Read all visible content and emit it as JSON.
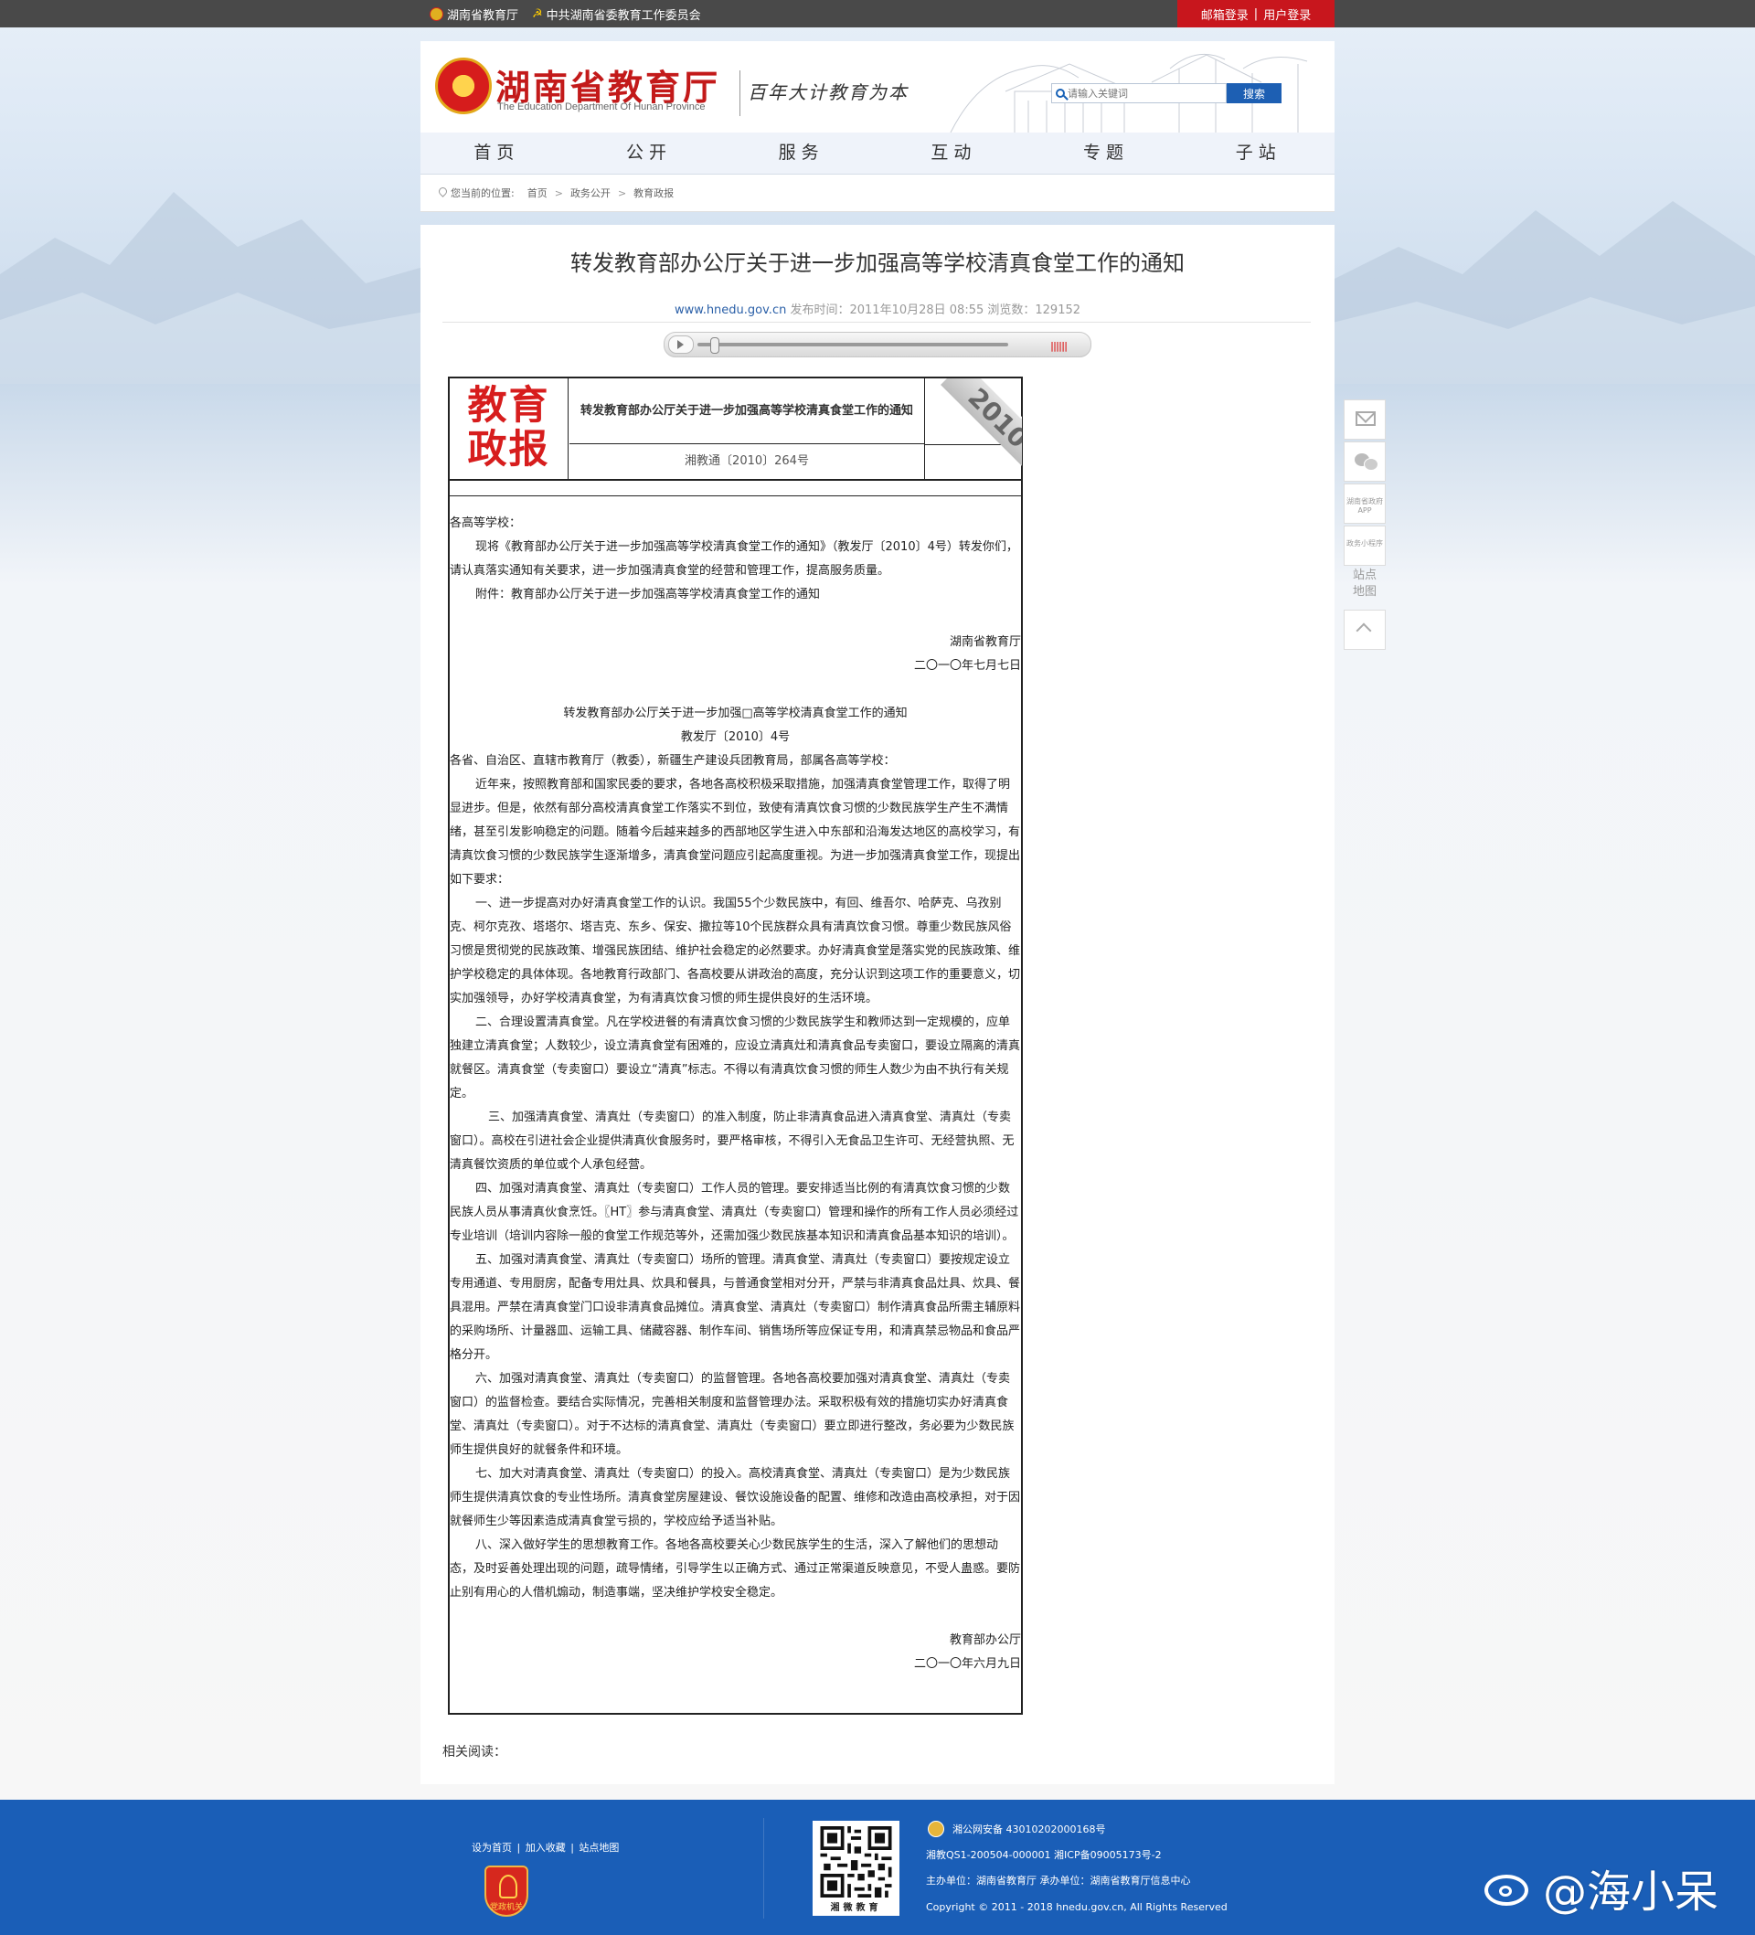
{
  "topbar": {
    "link1": "湖南省教育厅",
    "link2": "中共湖南省委教育工作委员会",
    "mail_login": "邮箱登录",
    "sep": "|",
    "user_login": "用户登录"
  },
  "header": {
    "logo_cn": "湖南省教育厅",
    "logo_en": "The Education Department Of Hunan Province",
    "slogan": "百年大计教育为本",
    "search_placeholder": "请输入关键词",
    "search_button": "搜索"
  },
  "nav": [
    "首页",
    "公开",
    "服务",
    "互动",
    "专题",
    "子站"
  ],
  "breadcrumb": {
    "label": "您当前的位置:",
    "items": [
      "首页",
      "政务公开",
      "教育政报"
    ],
    "sep": ">"
  },
  "article": {
    "title": "转发教育部办公厅关于进一步加强高等学校清真食堂工作的通知",
    "site": "www.hnedu.gov.cn",
    "meta": "发布时间：2011年10月28日 08:55 浏览数：129152",
    "player_volume": "||||||",
    "doc": {
      "stamp_line1": "教育",
      "stamp_line2": "政报",
      "title": "转发教育部办公厅关于进一步加强高等学校清真食堂工作的通知",
      "number": "湘教通〔2010〕264号",
      "year": "2010"
    },
    "body": {
      "salutation": "各高等学校：",
      "p1": "现将《教育部办公厅关于进一步加强高等学校清真食堂工作的通知》（教发厅〔2010〕4号）转发你们，请认真落实通知有关要求，进一步加强清真食堂的经营和管理工作，提高服务质量。",
      "attachment": "附件：教育部办公厅关于进一步加强高等学校清真食堂工作的通知",
      "sign1": "湖南省教育厅",
      "date1": "二〇一〇年七月七日",
      "sub_title": "转发教育部办公厅关于进一步加强□高等学校清真食堂工作的通知",
      "sub_number": "教发厅〔2010〕4号",
      "recipients": "各省、自治区、直辖市教育厅（教委），新疆生产建设兵团教育局，部属各高等学校：",
      "intro": "近年来，按照教育部和国家民委的要求，各地各高校积极采取措施，加强清真食堂管理工作，取得了明显进步。但是，依然有部分高校清真食堂工作落实不到位，致使有清真饮食习惯的少数民族学生产生不满情绪，甚至引发影响稳定的问题。随着今后越来越多的西部地区学生进入中东部和沿海发达地区的高校学习，有清真饮食习惯的少数民族学生逐渐增多，清真食堂问题应引起高度重视。为进一步加强清真食堂工作，现提出如下要求：",
      "s1": "一、进一步提高对办好清真食堂工作的认识。我国55个少数民族中，有回、维吾尔、哈萨克、乌孜别克、柯尔克孜、塔塔尔、塔吉克、东乡、保安、撒拉等10个民族群众具有清真饮食习惯。尊重少数民族风俗习惯是贯彻党的民族政策、增强民族团结、维护社会稳定的必然要求。办好清真食堂是落实党的民族政策、维护学校稳定的具体体现。各地教育行政部门、各高校要从讲政治的高度，充分认识到这项工作的重要意义，切实加强领导，办好学校清真食堂，为有清真饮食习惯的师生提供良好的生活环境。",
      "s2": "二、合理设置清真食堂。凡在学校进餐的有清真饮食习惯的少数民族学生和教师达到一定规模的，应单独建立清真食堂；人数较少，设立清真食堂有困难的，应设立清真灶和清真食品专卖窗口，要设立隔离的清真就餐区。清真食堂（专卖窗口）要设立“清真”标志。不得以有清真饮食习惯的师生人数少为由不执行有关规定。",
      "s3": "三、加强清真食堂、清真灶（专卖窗口）的准入制度，防止非清真食品进入清真食堂、清真灶（专卖窗口）。高校在引进社会企业提供清真伙食服务时，要严格审核，不得引入无食品卫生许可、无经营执照、无清真餐饮资质的单位或个人承包经营。",
      "s4": "四、加强对清真食堂、清真灶（专卖窗口）工作人员的管理。要安排适当比例的有清真饮食习惯的少数民族人员从事清真伙食烹饪。〖HT〗参与清真食堂、清真灶（专卖窗口）管理和操作的所有工作人员必须经过专业培训（培训内容除一般的食堂工作规范等外，还需加强少数民族基本知识和清真食品基本知识的培训）。",
      "s5": "五、加强对清真食堂、清真灶（专卖窗口）场所的管理。清真食堂、清真灶（专卖窗口）要按规定设立专用通道、专用厨房，配备专用灶具、炊具和餐具，与普通食堂相对分开，严禁与非清真食品灶具、炊具、餐具混用。严禁在清真食堂门口设非清真食品摊位。清真食堂、清真灶（专卖窗口）制作清真食品所需主辅原料的采购场所、计量器皿、运输工具、储藏容器、制作车间、销售场所等应保证专用，和清真禁忌物品和食品严格分开。",
      "s6": "六、加强对清真食堂、清真灶（专卖窗口）的监督管理。各地各高校要加强对清真食堂、清真灶（专卖窗口）的监督检查。要结合实际情况，完善相关制度和监督管理办法。采取积极有效的措施切实办好清真食堂、清真灶（专卖窗口）。对于不达标的清真食堂、清真灶（专卖窗口）要立即进行整改，务必要为少数民族师生提供良好的就餐条件和环境。",
      "s7": "七、加大对清真食堂、清真灶（专卖窗口）的投入。高校清真食堂、清真灶（专卖窗口）是为少数民族师生提供清真饮食的专业性场所。清真食堂房屋建设、餐饮设施设备的配置、维修和改造由高校承担，对于因就餐师生少等因素造成清真食堂亏损的，学校应给予适当补贴。",
      "s8": "八、深入做好学生的思想教育工作。各地各高校要关心少数民族学生的生活，深入了解他们的思想动态，及时妥善处理出现的问题，疏导情绪，引导学生以正确方式、通过正常渠道反映意见，不受人蛊惑。要防止别有用心的人借机煽动，制造事端，坚决维护学校安全稳定。",
      "sign2": "教育部办公厅",
      "date2": "二〇一〇年六月九日"
    },
    "related": "相关阅读："
  },
  "side": {
    "app_label": "湖南省政府APP",
    "miniprog_label": "政务小程序",
    "sitemap": "站点地图"
  },
  "footer": {
    "links": [
      "设为首页",
      "加入收藏",
      "站点地图"
    ],
    "badge": "党政机关",
    "qr_caption": "湘微教育",
    "police_record": "湘公网安备 43010202000168号",
    "icp": "湘教QS1-200504-000001 湘ICP备09005173号-2",
    "host": "主办单位：湖南省教育厅 承办单位：湖南省教育厅信息中心",
    "copyright": "Copyright © 2011 - 2018 hnedu.gov.cn, All Rights Reserved"
  },
  "watermark": "@海小呆"
}
